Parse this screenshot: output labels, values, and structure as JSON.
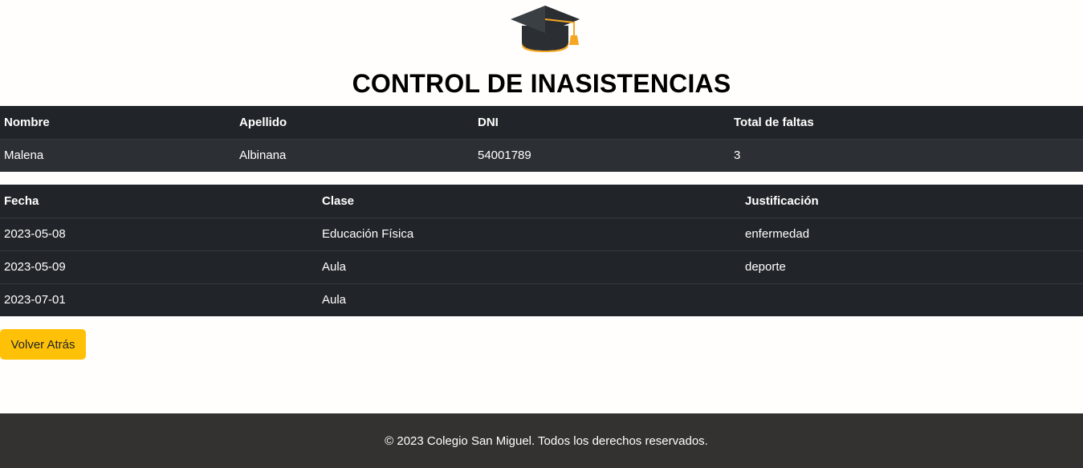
{
  "header": {
    "logo_icon": "graduation-cap-icon",
    "title": "CONTROL DE INASISTENCIAS"
  },
  "student_table": {
    "columns": [
      "Nombre",
      "Apellido",
      "DNI",
      "Total de faltas"
    ],
    "row": [
      "Malena",
      "Albinana",
      "54001789",
      "3"
    ]
  },
  "absence_table": {
    "columns": [
      "Fecha",
      "Clase",
      "Justificación"
    ],
    "rows": [
      [
        "2023-05-08",
        "Educación Física",
        "enfermedad"
      ],
      [
        "2023-05-09",
        "Aula",
        "deporte"
      ],
      [
        "2023-07-01",
        "Aula",
        ""
      ]
    ]
  },
  "actions": {
    "back_label": "Volver Atrás"
  },
  "footer": {
    "text": "© 2023 Colegio San Miguel. Todos los derechos reservados."
  },
  "colors": {
    "table_dark": "#212529",
    "button_warning": "#ffc107",
    "footer_bg": "#333231"
  }
}
